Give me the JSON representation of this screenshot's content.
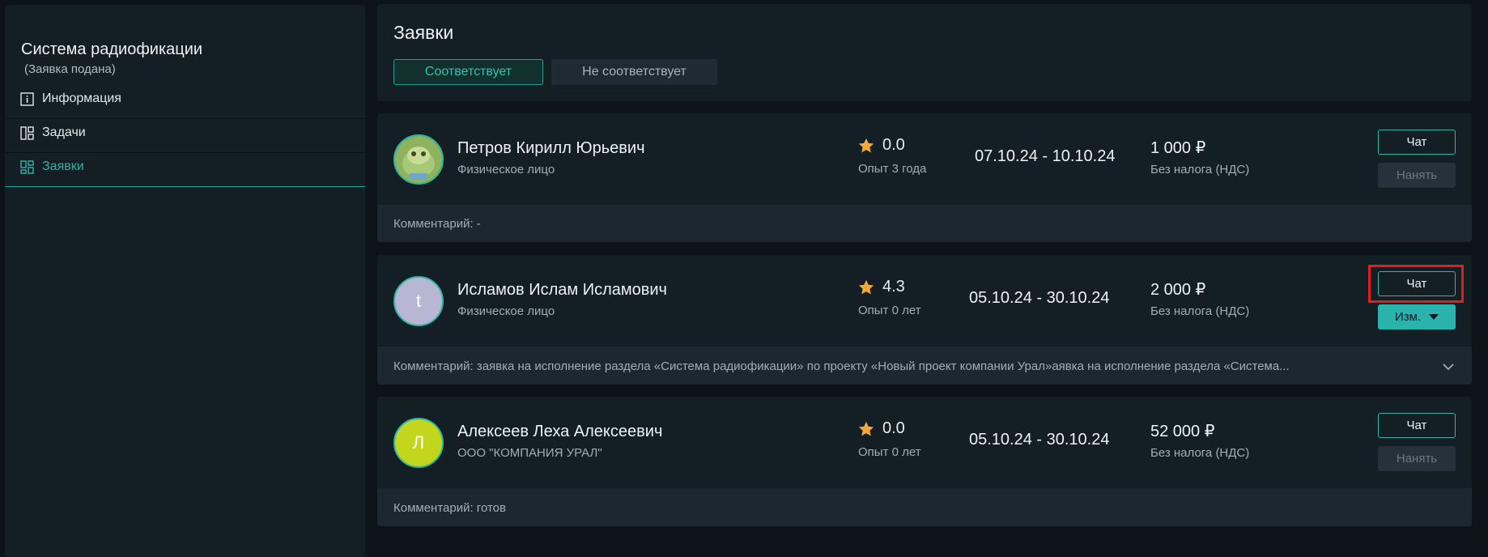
{
  "sidebar": {
    "title": "Система радиофикации",
    "subtitle": "(Заявка подана)",
    "items": [
      {
        "label": "Информация",
        "icon": "info-icon"
      },
      {
        "label": "Задачи",
        "icon": "layout-icon"
      },
      {
        "label": "Заявки",
        "icon": "grid-icon",
        "active": true
      }
    ]
  },
  "header": {
    "title": "Заявки",
    "tabs": [
      {
        "label": "Соответствует",
        "active": true
      },
      {
        "label": "Не соответствует",
        "active": false
      }
    ]
  },
  "applications": [
    {
      "name": "Петров Кирилл Юрьевич",
      "type": "Физическое лицо",
      "avatar": {
        "kind": "image",
        "letter": "",
        "color": "#9fc36a"
      },
      "rating": "0.0",
      "experience": "Опыт 3 года",
      "dates": "07.10.24 - 10.10.24",
      "price": "1 000 ₽",
      "tax": "Без налога (НДС)",
      "chat_label": "Чат",
      "action_label": "Нанять",
      "action_kind": "hire",
      "comment": "Комментарий: -"
    },
    {
      "name": "Исламов Ислам Исламович",
      "type": "Физическое лицо",
      "avatar": {
        "kind": "letter",
        "letter": "t",
        "color": "#b9b6d4"
      },
      "rating": "4.3",
      "experience": "Опыт 0 лет",
      "dates": "05.10.24 - 30.10.24",
      "price": "2 000 ₽",
      "tax": "Без налога (НДС)",
      "chat_label": "Чат",
      "action_label": "Изм.",
      "action_kind": "edit",
      "comment": "Комментарий: заявка на исполнение раздела «Система радиофикации» по проекту «Новый проект компании Урал»аявка на исполнение раздела «Система..."
    },
    {
      "name": "Алексеев Леха Алексеевич",
      "type": "ООО \"КОМПАНИЯ УРАЛ\"",
      "avatar": {
        "kind": "letter",
        "letter": "Л",
        "color": "#c3d61e"
      },
      "rating": "0.0",
      "experience": "Опыт 0 лет",
      "dates": "05.10.24 - 30.10.24",
      "price": "52 000 ₽",
      "tax": "Без налога (НДС)",
      "chat_label": "Чат",
      "action_label": "Нанять",
      "action_kind": "hire",
      "comment": "Комментарий: готов"
    }
  ],
  "colors": {
    "accent": "#2fb5a4",
    "highlight": "#e01e1e",
    "star": "#f2a93b"
  }
}
